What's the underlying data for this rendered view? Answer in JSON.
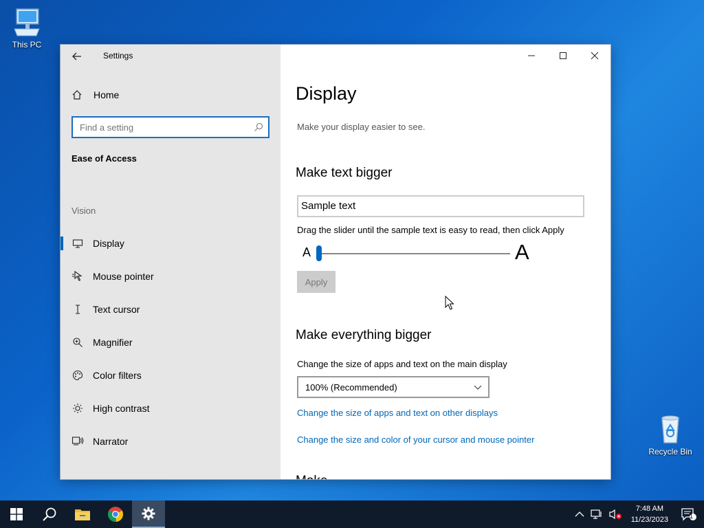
{
  "desktop": {
    "this_pc_label": "This PC",
    "recycle_bin_label": "Recycle Bin"
  },
  "window": {
    "app_title": "Settings",
    "controls": {
      "minimize": "minimize-icon",
      "maximize": "maximize-icon",
      "close": "close-icon"
    }
  },
  "sidebar": {
    "home_label": "Home",
    "search_placeholder": "Find a setting",
    "section_title": "Ease of Access",
    "group_title": "Vision",
    "items": [
      {
        "label": "Display",
        "icon": "monitor-icon",
        "active": true
      },
      {
        "label": "Mouse pointer",
        "icon": "mouse-pointer-icon",
        "active": false
      },
      {
        "label": "Text cursor",
        "icon": "text-cursor-icon",
        "active": false
      },
      {
        "label": "Magnifier",
        "icon": "magnifier-icon",
        "active": false
      },
      {
        "label": "Color filters",
        "icon": "palette-icon",
        "active": false
      },
      {
        "label": "High contrast",
        "icon": "sun-icon",
        "active": false
      },
      {
        "label": "Narrator",
        "icon": "narrator-icon",
        "active": false
      }
    ]
  },
  "content": {
    "title": "Display",
    "subtitle": "Make your display easier to see.",
    "text_bigger": {
      "heading": "Make text bigger",
      "sample_text": "Sample text",
      "instructions": "Drag the slider until the sample text is easy to read, then click Apply",
      "slider_min_label": "A",
      "slider_max_label": "A",
      "slider_value_fraction": 0.0,
      "apply_label": "Apply"
    },
    "everything_bigger": {
      "heading": "Make everything bigger",
      "instructions": "Change the size of apps and text on the main display",
      "scale_selected": "100% (Recommended)",
      "link_other_displays": "Change the size of apps and text on other displays",
      "link_cursor": "Change the size and color of your cursor and mouse pointer"
    },
    "cutoff_heading": "Make ... ..."
  },
  "taskbar": {
    "apps": [
      "start-icon",
      "search-icon",
      "file-explorer-icon",
      "chrome-icon",
      "settings-icon"
    ],
    "active_app": "settings-icon",
    "time": "7:48 AM",
    "date": "11/23/2023",
    "notification_count": "1"
  },
  "colors": {
    "accent": "#0067c0",
    "link": "#0067b8",
    "sidebar_bg": "#e6e6e6",
    "taskbar_bg": "#0f1a2b"
  }
}
